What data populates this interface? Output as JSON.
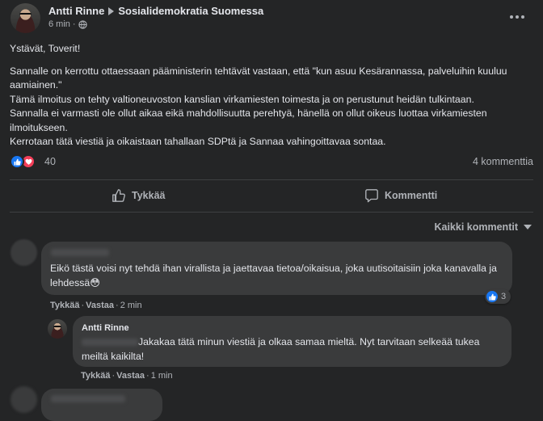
{
  "post": {
    "author": "Antti Rinne",
    "group": "Sosialidemokratia Suomessa",
    "time": "6 min",
    "paragraphs": [
      "Ystävät, Toverit!",
      "Sannalle on kerrottu ottaessaan pääministerin tehtävät vastaan, että \"kun asuu Kesärannassa, palveluihin kuuluu aamiainen.\"",
      "Tämä ilmoitus on tehty valtioneuvoston kanslian virkamiesten toimesta ja on perustunut heidän tulkintaan.",
      "Sannalla ei varmasti ole ollut aikaa eikä mahdollisuutta perehtyä, hänellä on ollut oikeus luottaa virkamiesten ilmoitukseen.",
      "Kerrotaan tätä viestiä ja oikaistaan tahallaan SDPtä ja Sannaa vahingoittavaa sontaa."
    ],
    "reaction_count": "40",
    "comment_count": "4 kommenttia"
  },
  "actions": {
    "like": "Tykkää",
    "comment": "Kommentti"
  },
  "sort": {
    "label": "Kaikki kommentit"
  },
  "comments": [
    {
      "text": "Eikö tästä voisi nyt tehdä ihan virallista ja jaettavaa tietoa/oikaisua, joka uutisoitaisiin joka kanavalla ja lehdessä",
      "emoji": "😳",
      "like": "Tykkää",
      "reply": "Vastaa",
      "time": "2 min",
      "reaction_count": "3"
    }
  ],
  "reply": {
    "author": "Antti Rinne",
    "text": "Jakakaa tätä minun viestiä ja olkaa samaa mieltä. Nyt tarvitaan selkeää tukea meiltä kaikilta!",
    "like": "Tykkää",
    "reply": "Vastaa",
    "time": "1 min"
  },
  "colors": {
    "background": "#242526",
    "bubble": "#3a3b3c",
    "like_blue": "#1877f2",
    "love_red": "#f33e58"
  },
  "icons": [
    "more-icon",
    "play-arrow-icon",
    "globe-icon",
    "thumbs-up-icon",
    "comment-icon",
    "heart-icon",
    "chevron-down-icon"
  ]
}
